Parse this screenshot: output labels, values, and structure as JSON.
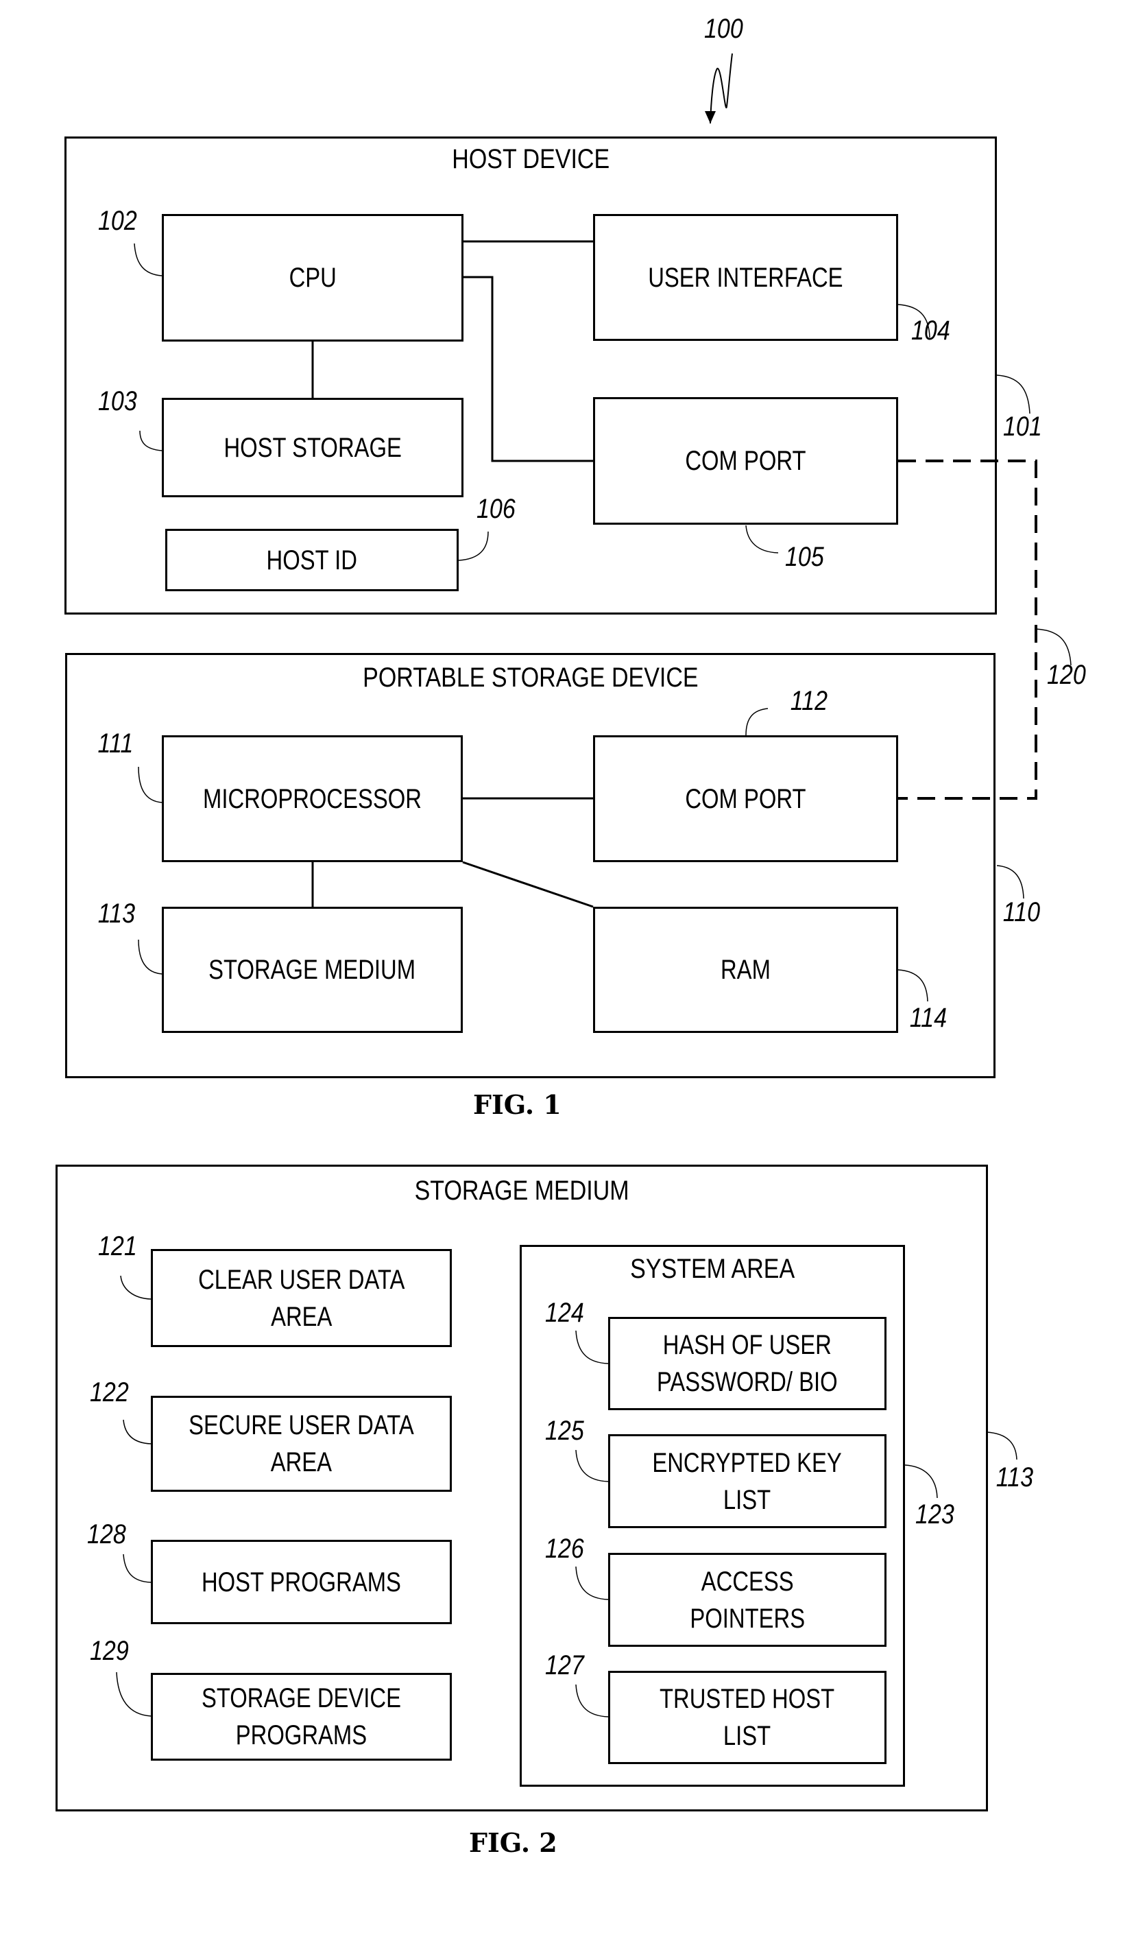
{
  "figure1": {
    "label": "FIG. 1",
    "system_ref": "100",
    "host_device": {
      "title": "HOST DEVICE",
      "ref": "101",
      "cpu": {
        "label": "CPU",
        "ref": "102"
      },
      "host_storage": {
        "label": "HOST STORAGE",
        "ref": "103"
      },
      "user_interface": {
        "label": "USER INTERFACE",
        "ref": "104"
      },
      "com_port": {
        "label": "COM PORT",
        "ref": "105"
      },
      "host_id": {
        "label": "HOST ID",
        "ref": "106"
      }
    },
    "portable_storage_device": {
      "title": "PORTABLE STORAGE DEVICE",
      "ref": "110",
      "microprocessor": {
        "label": "MICROPROCESSOR",
        "ref": "111"
      },
      "com_port": {
        "label": "COM PORT",
        "ref": "112"
      },
      "storage_medium": {
        "label": "STORAGE MEDIUM",
        "ref": "113"
      },
      "ram": {
        "label": "RAM",
        "ref": "114"
      }
    },
    "connection_ref": "120"
  },
  "figure2": {
    "label": "FIG. 2",
    "storage_medium": {
      "title": "STORAGE MEDIUM",
      "ref": "113",
      "clear_user_data_area": {
        "label": "CLEAR USER DATA\nAREA",
        "ref": "121"
      },
      "secure_user_data_area": {
        "label": "SECURE USER DATA\nAREA",
        "ref": "122"
      },
      "host_programs": {
        "label": "HOST PROGRAMS",
        "ref": "128"
      },
      "storage_device_programs": {
        "label": "STORAGE DEVICE\nPROGRAMS",
        "ref": "129"
      },
      "system_area": {
        "title": "SYSTEM AREA",
        "ref": "123",
        "hash": {
          "label": "HASH OF USER\nPASSWORD/ BIO",
          "ref": "124"
        },
        "encrypted_key_list": {
          "label": "ENCRYPTED KEY\nLIST",
          "ref": "125"
        },
        "access_pointers": {
          "label": "ACCESS\nPOINTERS",
          "ref": "126"
        },
        "trusted_host_list": {
          "label": "TRUSTED HOST\nLIST",
          "ref": "127"
        }
      }
    }
  }
}
